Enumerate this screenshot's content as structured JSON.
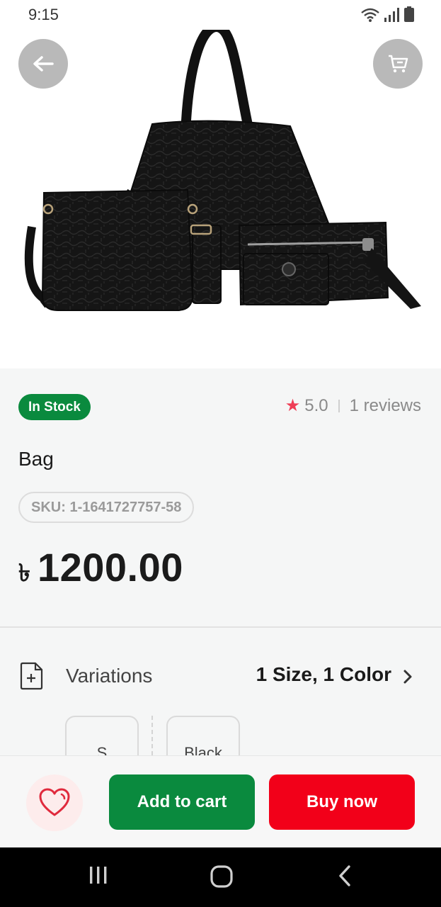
{
  "status_bar": {
    "time": "9:15"
  },
  "product": {
    "stock_label": "In Stock",
    "rating": "5.0",
    "reviews": "1 reviews",
    "name": "Bag",
    "sku": "SKU: 1-1641727757-58",
    "currency": "৳",
    "price": "1200.00"
  },
  "variations": {
    "label": "Variations",
    "summary": "1 Size, 1 Color",
    "options": {
      "size": "S",
      "color": "Black"
    }
  },
  "actions": {
    "add_to_cart": "Add to cart",
    "buy_now": "Buy now"
  },
  "colors": {
    "accent_green": "#0a8a3e",
    "buy_red": "#f20019",
    "star": "#ef3d55"
  },
  "icons": {
    "back": "arrow-left-icon",
    "cart": "cart-icon",
    "star": "star-icon",
    "variations": "add-file-icon",
    "chevron": "chevron-right-icon",
    "wishlist": "heart-icon"
  }
}
